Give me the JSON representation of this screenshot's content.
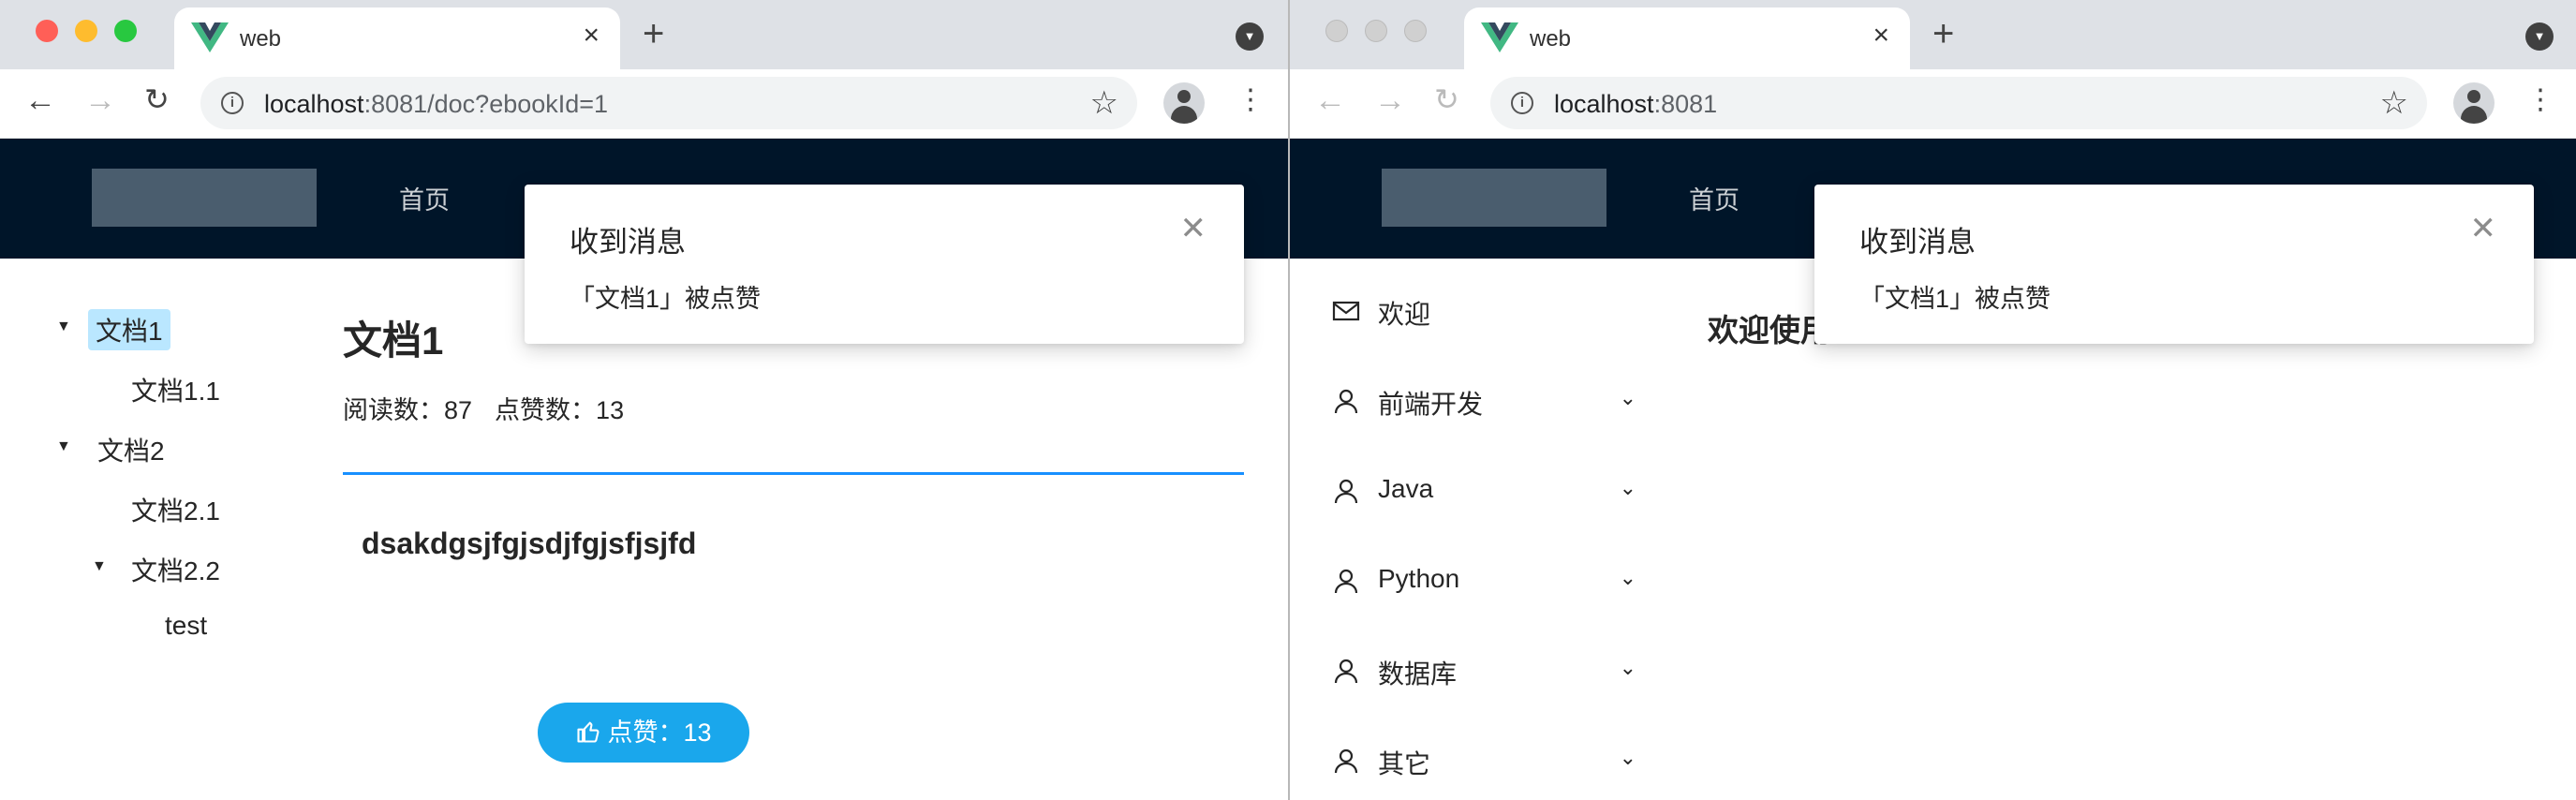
{
  "left": {
    "tab_title": "web",
    "url_host": "localhost",
    "url_rest": ":8081/doc?ebookId=1",
    "nav_home": "首页",
    "notification": {
      "title": "收到消息",
      "desc": "「文档1」被点赞"
    },
    "tree": [
      {
        "label": "文档1",
        "selected": true,
        "expanded": true,
        "level": 0
      },
      {
        "label": "文档1.1",
        "level": 1
      },
      {
        "label": "文档2",
        "expanded": true,
        "level": 0
      },
      {
        "label": "文档2.1",
        "level": 1
      },
      {
        "label": "文档2.2",
        "expanded": true,
        "level": 1
      },
      {
        "label": "test",
        "level": 2
      }
    ],
    "doc": {
      "title": "文档1",
      "read_label": "阅读数：87",
      "like_label": "点赞数：13",
      "content": "dsakdgsjfgjsdjfgjsfjsjfd",
      "vote_button": "点赞：13"
    }
  },
  "right": {
    "tab_title": "web",
    "url_host": "localhost",
    "url_rest": ":8081",
    "nav_home": "首页",
    "notification": {
      "title": "收到消息",
      "desc": "「文档1」被点赞"
    },
    "menu": [
      {
        "label": "欢迎",
        "icon": "mail-icon",
        "has_children": false
      },
      {
        "label": "前端开发",
        "icon": "user-icon",
        "has_children": true
      },
      {
        "label": "Java",
        "icon": "user-icon",
        "has_children": true
      },
      {
        "label": "Python",
        "icon": "user-icon",
        "has_children": true
      },
      {
        "label": "数据库",
        "icon": "user-icon",
        "has_children": true
      },
      {
        "label": "其它",
        "icon": "user-icon",
        "has_children": true
      }
    ],
    "welcome": "欢迎使用"
  },
  "colors": {
    "header": "#001529",
    "accent": "#1890ff",
    "selected": "#bae7ff",
    "like_button": "#1aa7ec"
  }
}
